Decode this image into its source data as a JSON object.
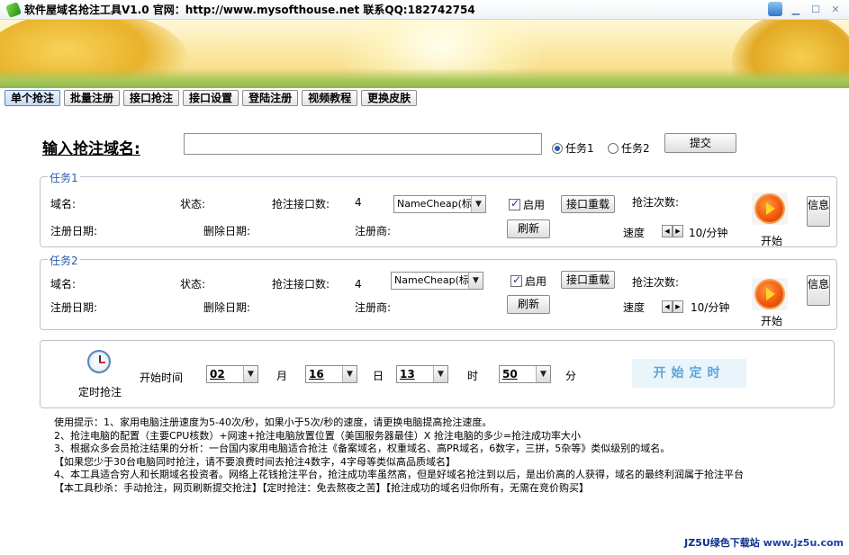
{
  "window": {
    "title": "软件屋域名抢注工具V1.0 官网：http://www.mysofthouse.net 联系QQ:182742754",
    "controls": [
      "skin",
      "minimize",
      "maximize",
      "close"
    ]
  },
  "tabs": [
    {
      "label": "单个抢注",
      "active": true
    },
    {
      "label": "批量注册",
      "active": false
    },
    {
      "label": "接口抢注",
      "active": false
    },
    {
      "label": "接口设置",
      "active": false
    },
    {
      "label": "登陆注册",
      "active": false
    },
    {
      "label": "视频教程",
      "active": false
    },
    {
      "label": "更换皮肤",
      "active": false
    }
  ],
  "domain_entry": {
    "label": "输入抢注域名:",
    "value": "",
    "task1_label": "任务1",
    "task2_label": "任务2",
    "selected_task": "任务1",
    "submit_label": "提交"
  },
  "task_groups": [
    {
      "title": "任务1",
      "domain_label": "域名:",
      "status_label": "状态:",
      "api_count_label": "抢注接口数:",
      "api_count": "4",
      "registrar_select": "NameCheap(标)",
      "enable_label": "启用",
      "enabled": true,
      "reload_label": "接口重载",
      "attempts_label": "抢注次数:",
      "reg_date_label": "注册日期:",
      "del_date_label": "删除日期:",
      "registrar_label": "注册商:",
      "refresh_label": "刷新",
      "speed_label": "速度",
      "speed_value": "10/分钟",
      "start_label": "开始",
      "info_label": "信息"
    },
    {
      "title": "任务2",
      "domain_label": "域名:",
      "status_label": "状态:",
      "api_count_label": "抢注接口数:",
      "api_count": "4",
      "registrar_select": "NameCheap(标)",
      "enable_label": "启用",
      "enabled": true,
      "reload_label": "接口重载",
      "attempts_label": "抢注次数:",
      "reg_date_label": "注册日期:",
      "del_date_label": "删除日期:",
      "registrar_label": "注册商:",
      "refresh_label": "刷新",
      "speed_label": "速度",
      "speed_value": "10/分钟",
      "start_label": "开始",
      "info_label": "信息"
    }
  ],
  "timer": {
    "icon_label": "定时抢注",
    "start_time_label": "开始时间",
    "month": "02",
    "month_unit": "月",
    "day": "16",
    "day_unit": "日",
    "hour": "13",
    "hour_unit": "时",
    "minute": "50",
    "minute_unit": "分",
    "start_button": "开始定时"
  },
  "tips": [
    "使用提示：1、家用电脑注册速度为5-40次/秒，如果小于5次/秒的速度，请更换电脑提高抢注速度。",
    "2、抢注电脑的配置（主要CPU核数）+网速+抢注电脑放置位置（美国服务器最佳）X 抢注电脑的多少=抢注成功率大小",
    "3、根据众多会员抢注结果的分析：一台国内家用电脑适合抢注《备案域名，权重域名、高PR域名，6数字，三拼，5杂等》类似级别的域名。",
    "【如果您少于30台电脑同时抢注，请不要浪费时间去抢注4数字，4字母等类似高品质域名】",
    "4、本工具适合穷人和长期域名投资者。网络上花钱抢注平台，抢注成功率虽然高，但是好域名抢注到以后，是出价高的人获得，域名的最终利润属于抢注平台",
    "【本工具秒杀：手动抢注，网页刷新提交抢注】【定时抢注：免去熬夜之苦】【抢注成功的域名归你所有，无需在竞价购买】"
  ],
  "footer": {
    "brand": "JZ5U绿色下载站",
    "url": "www.jz5u.com"
  }
}
